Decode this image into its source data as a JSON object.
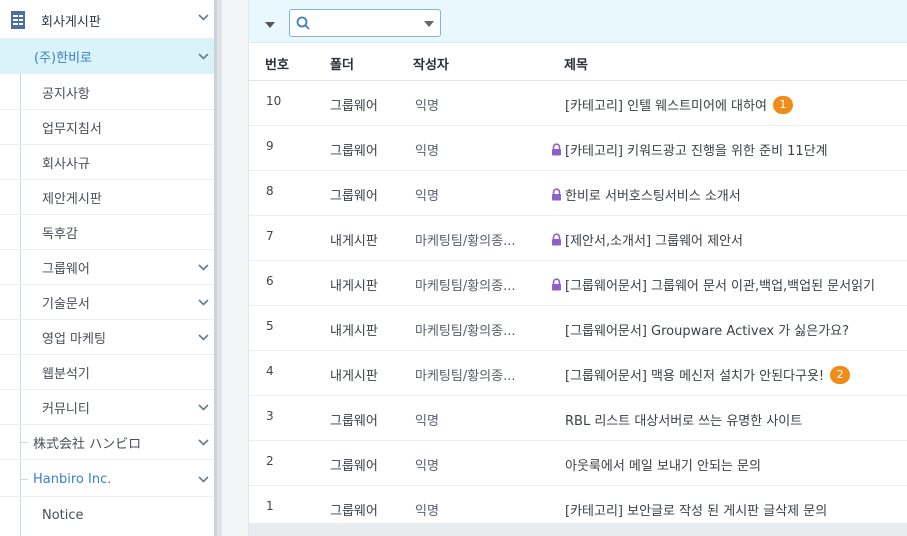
{
  "sidebar": {
    "top_group": "회사게시판",
    "active_sub": "(주)한비로",
    "items": [
      {
        "label": "공지사항",
        "expandable": false
      },
      {
        "label": "업무지침서",
        "expandable": false
      },
      {
        "label": "회사사규",
        "expandable": false
      },
      {
        "label": "제안게시판",
        "expandable": false
      },
      {
        "label": "독후감",
        "expandable": false
      },
      {
        "label": "그룹웨어",
        "expandable": true
      },
      {
        "label": "기술문서",
        "expandable": true
      },
      {
        "label": "영업 마케팅",
        "expandable": true
      },
      {
        "label": "웹분석기",
        "expandable": false
      },
      {
        "label": "커뮤니티",
        "expandable": true
      }
    ],
    "other_subs": [
      {
        "label": "株式会社 ハンビロ"
      },
      {
        "label": "Hanbiro Inc."
      }
    ],
    "last_leaf": "Notice"
  },
  "toolbar": {
    "search_placeholder": "",
    "search_value": ""
  },
  "table": {
    "headers": {
      "no": "번호",
      "folder": "폴더",
      "author": "작성자",
      "title": "제목"
    },
    "rows": [
      {
        "no": "10",
        "folder": "그룹웨어",
        "author": "익명",
        "title": "[카테고리] 인텔 웨스트미어에 대하여",
        "locked": false,
        "badge": "1"
      },
      {
        "no": "9",
        "folder": "그룹웨어",
        "author": "익명",
        "title": "[카테고리] 키워드광고 진행을 위한 준비 11단계",
        "locked": true,
        "badge": ""
      },
      {
        "no": "8",
        "folder": "그룹웨어",
        "author": "익명",
        "title": "한비로 서버호스팅서비스 소개서",
        "locked": true,
        "badge": ""
      },
      {
        "no": "7",
        "folder": "내게시판",
        "author": "마케팅팀/황의종...",
        "title": "[제안서,소개서] 그룹웨어 제안서",
        "locked": true,
        "badge": ""
      },
      {
        "no": "6",
        "folder": "내게시판",
        "author": "마케팅팀/황의종...",
        "title": "[그룹웨어문서] 그룹웨어 문서 이관,백업,백업된 문서읽기",
        "locked": true,
        "badge": ""
      },
      {
        "no": "5",
        "folder": "내게시판",
        "author": "마케팅팀/황의종...",
        "title": "[그룹웨어문서] Groupware Activex 가 싫은가요?",
        "locked": false,
        "badge": ""
      },
      {
        "no": "4",
        "folder": "내게시판",
        "author": "마케팅팀/황의종...",
        "title": "[그룹웨어문서] 맥용 메신저 설치가 안된다구욧!",
        "locked": false,
        "badge": "2"
      },
      {
        "no": "3",
        "folder": "그룹웨어",
        "author": "익명",
        "title": "RBL 리스트 대상서버로 쓰는 유명한 사이트",
        "locked": false,
        "badge": ""
      },
      {
        "no": "2",
        "folder": "그룹웨어",
        "author": "익명",
        "title": "아웃룩에서 메일 보내기 안되는 문의",
        "locked": false,
        "badge": ""
      },
      {
        "no": "1",
        "folder": "그룹웨어",
        "author": "익명",
        "title": "[카테고리] 보안글로 작성 된 게시판 글삭제 문의",
        "locked": false,
        "badge": ""
      }
    ]
  },
  "colors": {
    "accent": "#3b7fc4",
    "active_bg": "#daf3fb",
    "toolbar_bg": "#e8f8fc",
    "badge": "#ef8d1a",
    "lock": "#8e5fc4"
  }
}
